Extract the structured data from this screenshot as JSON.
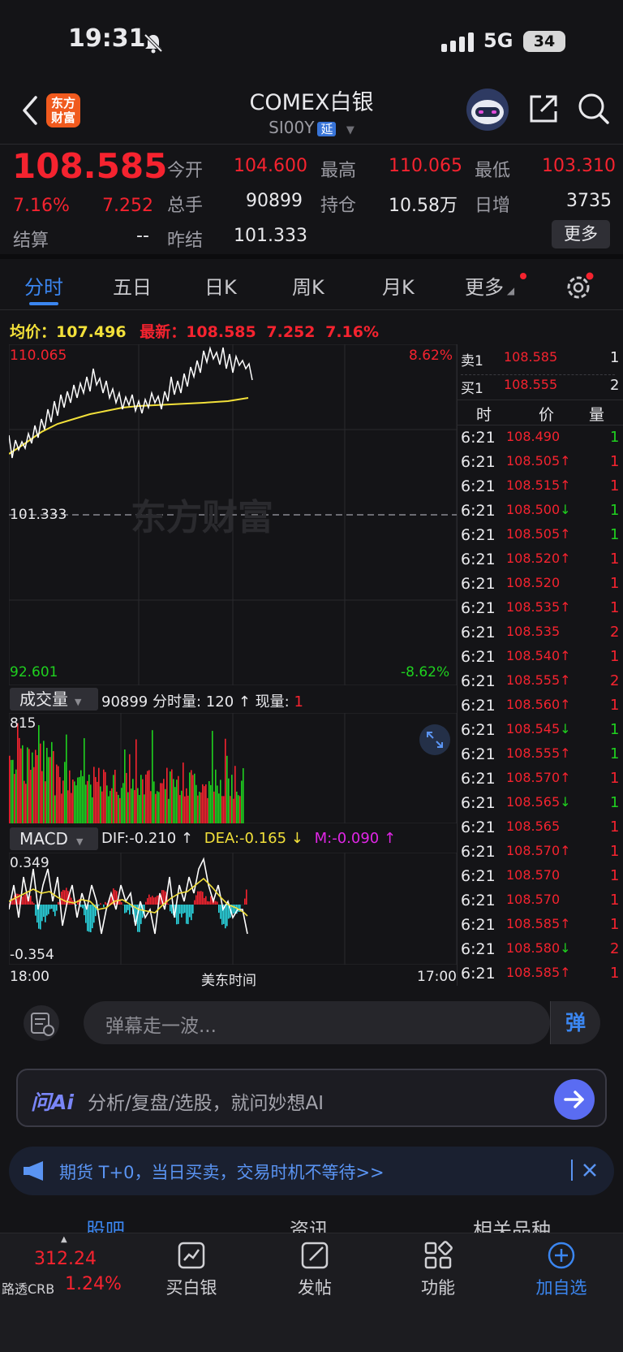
{
  "status": {
    "time": "19:31",
    "network": "5G",
    "battery": "34"
  },
  "header": {
    "title": "COMEX白银",
    "code": "SI00Y",
    "delay_badge": "延",
    "logo_text": "东方财富"
  },
  "quote": {
    "price": "108.585",
    "change_pct": "7.16%",
    "change": "7.252",
    "settle_label": "结算",
    "settle_value": "--",
    "open_label": "今开",
    "open_value": "104.600",
    "volume_label": "总手",
    "volume_value": "90899",
    "prev_settle_label": "昨结",
    "prev_settle_value": "101.333",
    "high_label": "最高",
    "high_value": "110.065",
    "oi_label": "持仓",
    "oi_value": "10.58万",
    "low_label": "最低",
    "low_value": "103.310",
    "daily_inc_label": "日增",
    "daily_inc_value": "3735",
    "more_label": "更多"
  },
  "tabs": [
    "分时",
    "五日",
    "日K",
    "周K",
    "月K",
    "更多"
  ],
  "chart_info": {
    "avg_label": "均价：",
    "avg_value": "107.496",
    "last_label": "最新：",
    "last_value": "108.585",
    "last_change": "7.252",
    "last_pct": "7.16%"
  },
  "chart_data": {
    "type": "line",
    "price_axis": {
      "max": "110.065",
      "mid": "101.333",
      "min": "92.601",
      "max_pct": "8.62%",
      "min_pct": "-8.62%"
    },
    "x_axis": {
      "start": "18:00",
      "middle": "美东时间",
      "end": "17:00"
    },
    "watermark": "东方财富",
    "volume_panel": {
      "label": "成交量",
      "total": "90899",
      "info": "分时量: 120 ↑ 现量:",
      "current": "1",
      "ymax": "815"
    },
    "macd_panel": {
      "label": "MACD",
      "dif": "DIF:-0.210 ↑",
      "dea": "DEA:-0.165 ↓",
      "m": "M:-0.090 ↑",
      "ymax": "0.349",
      "ymin": "-0.354"
    }
  },
  "order_book": {
    "ask_label": "卖1",
    "ask_price": "108.585",
    "ask_qty": "1",
    "bid_label": "买1",
    "bid_price": "108.555",
    "bid_qty": "2",
    "headers": [
      "时",
      "价",
      "量"
    ],
    "trades": [
      {
        "t": "6:21",
        "p": "108.490",
        "d": "",
        "q": "1",
        "qc": "green"
      },
      {
        "t": "6:21",
        "p": "108.505",
        "d": "↑",
        "q": "1",
        "qc": "red"
      },
      {
        "t": "6:21",
        "p": "108.515",
        "d": "↑",
        "q": "1",
        "qc": "red"
      },
      {
        "t": "6:21",
        "p": "108.500",
        "d": "↓",
        "q": "1",
        "qc": "green"
      },
      {
        "t": "6:21",
        "p": "108.505",
        "d": "↑",
        "q": "1",
        "qc": "green"
      },
      {
        "t": "6:21",
        "p": "108.520",
        "d": "↑",
        "q": "1",
        "qc": "red"
      },
      {
        "t": "6:21",
        "p": "108.520",
        "d": "",
        "q": "1",
        "qc": "red"
      },
      {
        "t": "6:21",
        "p": "108.535",
        "d": "↑",
        "q": "1",
        "qc": "red"
      },
      {
        "t": "6:21",
        "p": "108.535",
        "d": "",
        "q": "2",
        "qc": "red"
      },
      {
        "t": "6:21",
        "p": "108.540",
        "d": "↑",
        "q": "1",
        "qc": "red"
      },
      {
        "t": "6:21",
        "p": "108.555",
        "d": "↑",
        "q": "2",
        "qc": "red"
      },
      {
        "t": "6:21",
        "p": "108.560",
        "d": "↑",
        "q": "1",
        "qc": "red"
      },
      {
        "t": "6:21",
        "p": "108.545",
        "d": "↓",
        "q": "1",
        "qc": "green"
      },
      {
        "t": "6:21",
        "p": "108.555",
        "d": "↑",
        "q": "1",
        "qc": "green"
      },
      {
        "t": "6:21",
        "p": "108.570",
        "d": "↑",
        "q": "1",
        "qc": "red"
      },
      {
        "t": "6:21",
        "p": "108.565",
        "d": "↓",
        "q": "1",
        "qc": "green"
      },
      {
        "t": "6:21",
        "p": "108.565",
        "d": "",
        "q": "1",
        "qc": "red"
      },
      {
        "t": "6:21",
        "p": "108.570",
        "d": "↑",
        "q": "1",
        "qc": "red"
      },
      {
        "t": "6:21",
        "p": "108.570",
        "d": "",
        "q": "1",
        "qc": "red"
      },
      {
        "t": "6:21",
        "p": "108.570",
        "d": "",
        "q": "1",
        "qc": "red"
      },
      {
        "t": "6:21",
        "p": "108.585",
        "d": "↑",
        "q": "1",
        "qc": "red"
      },
      {
        "t": "6:21",
        "p": "108.580",
        "d": "↓",
        "q": "2",
        "qc": "red"
      },
      {
        "t": "6:21",
        "p": "108.585",
        "d": "↑",
        "q": "1",
        "qc": "red"
      }
    ]
  },
  "comment": {
    "placeholder": "弹幕走一波...",
    "danmu_label": "弹"
  },
  "ai": {
    "logo": "问Ai",
    "placeholder": "分析/复盘/选股，就问妙想AI"
  },
  "promo": {
    "text": "期货 T+0，当日买卖，交易时机不等待>>"
  },
  "sub_tabs": [
    "股吧",
    "资讯",
    "相关品种"
  ],
  "bottom_nav": {
    "index_value": "312.24",
    "index_name": "路透CRB",
    "index_pct": "1.24%",
    "buy_label": "买白银",
    "post_label": "发帖",
    "func_label": "功能",
    "add_label": "加自选"
  }
}
